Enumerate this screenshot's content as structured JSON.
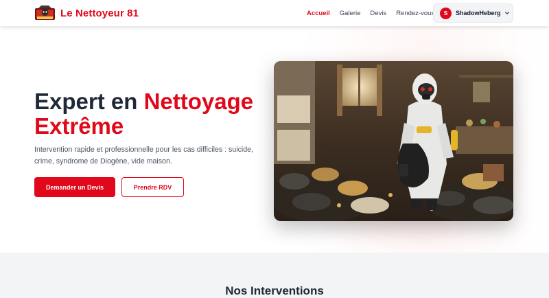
{
  "navbar": {
    "brand_name": "Le Nettoyeur 81",
    "logo_icon": "brand-logo-icon",
    "links": [
      {
        "label": "Accueil",
        "active": true
      },
      {
        "label": "Galerie",
        "active": false
      },
      {
        "label": "Devis",
        "active": false
      },
      {
        "label": "Rendez-vous",
        "active": false
      }
    ],
    "user": {
      "initial": "S",
      "name": "ShadowHeberg",
      "icon": "chevron-down-icon"
    }
  },
  "hero": {
    "title_part1": "Expert en ",
    "title_accent": "Nettoyage",
    "title_part2": "Extrême",
    "description": "Intervention rapide et professionnelle pour les cas difficiles : suicide, crime, syndrome de Diogène, vide maison.",
    "primary_button": "Demander un Devis",
    "secondary_button": "Prendre RDV"
  },
  "interventions": {
    "title": "Nos Interventions"
  },
  "colors": {
    "accent": "#e0081a",
    "text_dark": "#1f2937",
    "section_bg": "#f3f4f6"
  }
}
